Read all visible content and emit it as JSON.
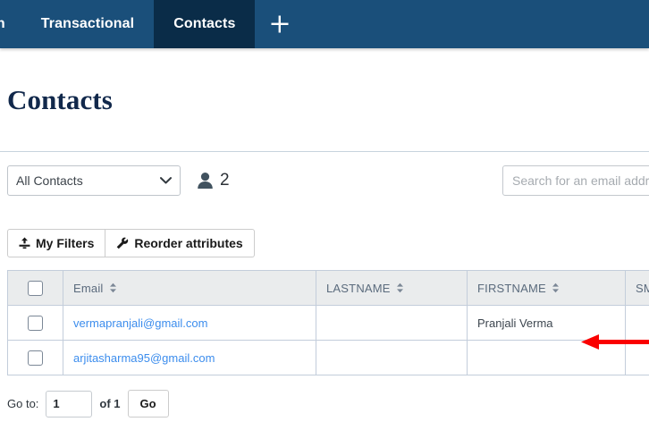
{
  "navbar": {
    "tabs": [
      {
        "label": "on",
        "active": false,
        "truncated": true
      },
      {
        "label": "Transactional",
        "active": false,
        "truncated": false
      },
      {
        "label": "Contacts",
        "active": true,
        "truncated": false
      }
    ],
    "add_tab_icon": "plus-icon",
    "background_color": "#1a4f7a",
    "active_tab_color": "#0a2c48"
  },
  "page": {
    "title": "Contacts"
  },
  "filters": {
    "list_select": {
      "selected": "All Contacts",
      "options": [
        "All Contacts"
      ],
      "chevron_icon": "chevron-down-icon"
    },
    "contact_count": {
      "icon": "person-icon",
      "value": "2"
    },
    "search": {
      "value": "",
      "placeholder": "Search for an email address"
    }
  },
  "toolbar": {
    "my_filters_label": "My Filters",
    "my_filters_icon": "upload-icon",
    "reorder_label": "Reorder attributes",
    "reorder_icon": "wrench-icon"
  },
  "table": {
    "select_all_checkbox": false,
    "columns": [
      {
        "key": "check",
        "label": "",
        "sortable": false
      },
      {
        "key": "email",
        "label": "Email",
        "sortable": true
      },
      {
        "key": "lastname",
        "label": "LASTNAME",
        "sortable": true
      },
      {
        "key": "firstname",
        "label": "FIRSTNAME",
        "sortable": true
      },
      {
        "key": "sms",
        "label": "SMS",
        "sortable": true
      }
    ],
    "rows": [
      {
        "checked": false,
        "email": "vermapranjali@gmail.com",
        "lastname": "",
        "firstname": "Pranjali Verma",
        "sms": ""
      },
      {
        "checked": false,
        "email": "arjitasharma95@gmail.com",
        "lastname": "",
        "firstname": "",
        "sms": ""
      }
    ],
    "link_color": "#3c8ded",
    "header_background": "#eaeced"
  },
  "pagination": {
    "goto_label": "Go to:",
    "page_value": "1",
    "of_label": "of 1",
    "go_button": "Go"
  },
  "annotation": {
    "arrow_color": "#fa0000",
    "points_to": "firstname-cell-row-1"
  }
}
